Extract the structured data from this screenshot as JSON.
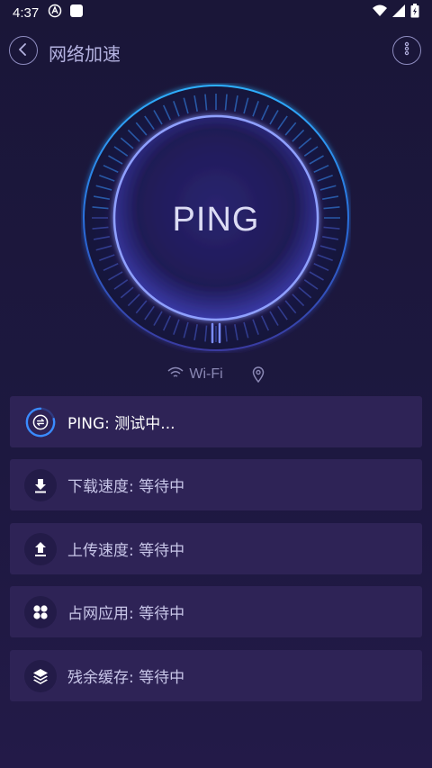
{
  "status_bar": {
    "time": "4:37"
  },
  "header": {
    "title": "网络加速"
  },
  "gauge": {
    "label": "PING"
  },
  "network": {
    "type": "Wi-Fi"
  },
  "tests": [
    {
      "label": "PING: 测试中...",
      "icon": "ping-spinner-icon"
    },
    {
      "label": "下载速度: 等待中",
      "icon": "download-icon"
    },
    {
      "label": "上传速度: 等待中",
      "icon": "upload-icon"
    },
    {
      "label": "占网应用: 等待中",
      "icon": "apps-icon"
    },
    {
      "label": "残余缓存: 等待中",
      "icon": "layers-icon"
    }
  ],
  "colors": {
    "background": "#1a1638",
    "card": "#2e2356",
    "accent_blue": "#3a7bff",
    "ring_glow": "#2fa8ff"
  }
}
